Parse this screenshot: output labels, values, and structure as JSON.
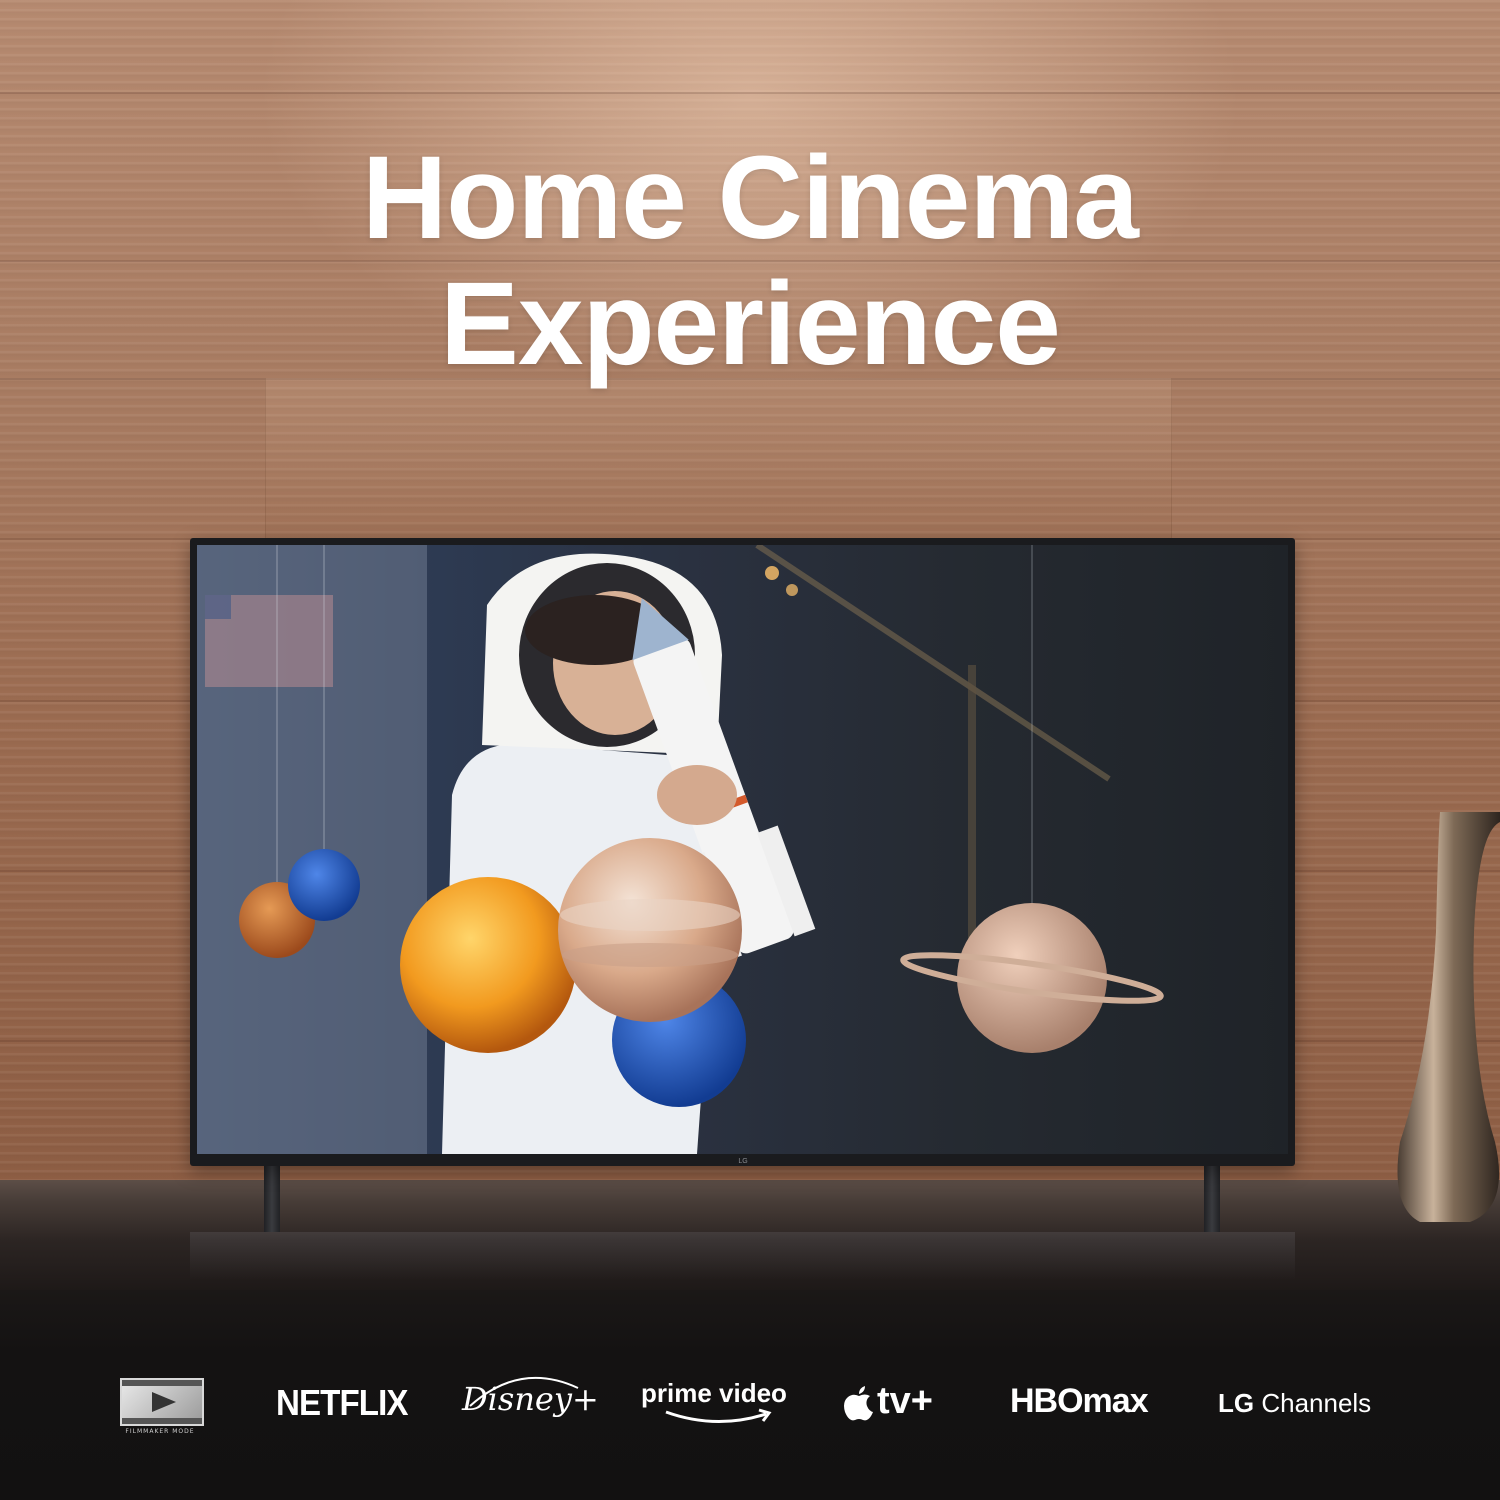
{
  "headline": {
    "line1": "Home Cinema",
    "line2": "Experience"
  },
  "tv": {
    "brand_mark": "LG"
  },
  "streaming_logos": {
    "filmmaker_caption": "FILMMAKER MODE",
    "netflix": "NETFLIX",
    "disney": "Disney+",
    "prime": "prime video",
    "apple_tv": "tv+",
    "hbo_max": "HBOmax",
    "lg_channels_brand": "LG",
    "lg_channels_text": " Channels"
  },
  "colors": {
    "headline_text": "#ffffff",
    "wood_wall": "#a87b61",
    "bottom_bar": "#141212",
    "tv_frame": "#1a1b1e"
  },
  "icons": [
    "filmmaker-mode-icon",
    "apple-icon",
    "amazon-smile-icon",
    "vase-icon"
  ]
}
